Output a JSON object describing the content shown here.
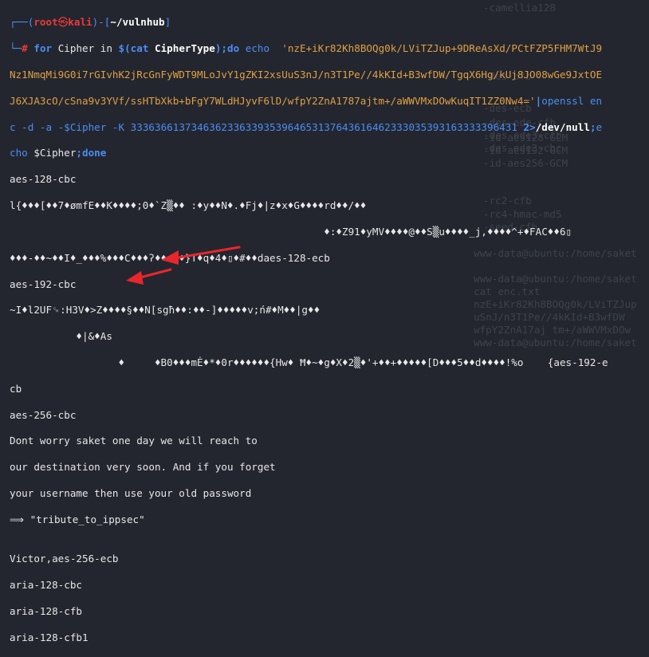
{
  "background_ghost": [
    "-camellia128",
    "-des-ecb",
    "-des-ede-cfb",
    "-des-ede3-cfb",
    "-des-ede3-cbc",
    "-des-ofb",
    "-id-aes128-GCM",
    "-id-aes192-GCM",
    "-id-aes256-GCM",
    "-rc2-cfb",
    "-rc4-hmac-md5",
    "-seed-cfb",
    "www-data@ubuntu:/home/saket",
    "www-data@ubuntu:/home/saket",
    "cat enc.txt",
    "nzE+iKr82Kh8BOQg0k/LViTZJup",
    "uSnJ/n3T1Pe//4kKId+B3wfDW",
    "wfpY2ZnA17aj tm+/aWWVMxDOw",
    "www-data@ubuntu:/home/saket",
    "www-data@ubuntu:/home/saket",
    "www-data@ubuntu:/home/saket"
  ],
  "prompt": {
    "open": "┌──(",
    "user": "root",
    "at": "㉿",
    "host": "kali",
    "close": ")-[",
    "path": "~/vulnhub",
    "end": "]",
    "line2": "└─",
    "hash": "#"
  },
  "command": {
    "part1_kw": "for",
    "part1": " Cipher in ",
    "part2_sub": "$(cat ",
    "part2_word": "CipherType",
    "part2_close": ");",
    "part3_kw": "do",
    "part3_echo": " echo  ",
    "b64_1": "'nzE+iKr82Kh8BOQg0k/LViTZJup+9DReAsXd/PCtFZP5FHM7WtJ9",
    "b64_2": "Nz1NmqMi9G0i7rGIvhK2jRcGnFyWDT9MLoJvY1gZKI2xsUuS3nJ/n3T1Pe//4kKId+B3wfDW/TgqX6Hg/kUj8JO08wGe9JxtOE",
    "b64_3": "J6XJA3cO/cSna9v3YVf/ssHTbXkb+bFgY7WLdHJyvF6lD/wfpY2ZnA1787ajtm+/aWWVMxDOwKuqIT1ZZ0Nw4='",
    "pipe": "|",
    "openssl": "openssl",
    "en": " en",
    "line4a": "c -d -a -",
    "line4b": "$Cipher",
    "line4c": " -K ",
    "key": "3336366137346362336339353964653137643616462333035393163333396431",
    "redir": " 2>",
    "devnull": "/dev/null",
    "semi": ";",
    "e": "e",
    "line5a": "cho ",
    "line5b": "$Cipher",
    "line5c": ";",
    "done": "done"
  },
  "output": {
    "l01": "aes-128-cbc",
    "l02": "l{♦♦♦[♦♦7♦ømfE♦♦K♦♦♦♦;0♦`Z▒♦♦ :♦y♦♦N♦.♦Fj♦|z♦x♦G♦♦♦♦rd♦♦/♦♦",
    "l03": "                                                    ♦:♦Z91♦yMV♦♦♦♦@♦♦S▒u♦♦♦♦_j,♦♦♦♦^+♦FAC♦♦6▯",
    "l04": "♦♦♦-♦♦~♦♦I♦_♦♦♦%♦♦♦C♦♦♦ʔ♦♦:♦♦}T♦q♦4♦▯♦#♦♦daes-128-ecb",
    "l05": "aes-192-cbc",
    "l06": "~I♦l2UF␍:H3V♦>Z♦♦♦♦§♦♦N[sgħ♦♦:♦♦-]♦♦♦♦♦v;ń#♦M♦♦|g♦♦",
    "l07": "           ♦|&♦As",
    "l08": "                  ♦     ♦B0♦♦♦mĖ♦*♦0r♦♦♦♦♦♦{Hw♦ Ħ♦~♦g♦X♦2▒♦'+♦♦+♦♦♦♦♦[D♦♦♦5♦♦d♦♦♦♦!%o    {aes-192-e",
    "l09": "cb",
    "l10": "aes-256-cbc",
    "l11": "Dont worry saket one day we will reach to",
    "l12": "our destination very soon. And if you forget",
    "l13": "your username then use your old password",
    "l14": "⟹ \"tribute_to_ippsec\"",
    "l15": "",
    "l16": "Victor,aes-256-ecb",
    "l17": "aria-128-cbc",
    "l18": "aria-128-cfb",
    "l19": "aria-128-cfb1"
  },
  "annotation_color": "#e8262b"
}
